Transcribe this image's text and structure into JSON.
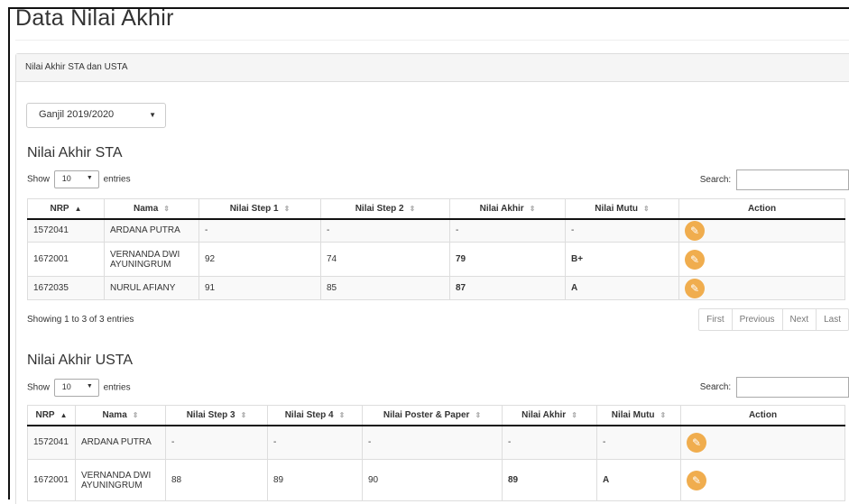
{
  "page_title": "Data Nilai Akhir",
  "panel": {
    "heading": "Nilai Akhir STA dan USTA",
    "semester": "Ganjil 2019/2020"
  },
  "colors": {
    "edit_button": "#f0ad4e",
    "row_stripe": "#f9f9f9"
  },
  "sta": {
    "title": "Nilai Akhir STA",
    "show_label": "Show",
    "entries_value": "10",
    "entries_label": "entries",
    "search_label": "Search:",
    "columns": [
      "NRP",
      "Nama",
      "Nilai Step 1",
      "Nilai Step 2",
      "Nilai Akhir",
      "Nilai Mutu",
      "Action"
    ],
    "rows": [
      {
        "nrp": "1572041",
        "nama": "ARDANA PUTRA",
        "step1": "-",
        "step2": "-",
        "akhir": "-",
        "mutu": "-"
      },
      {
        "nrp": "1672001",
        "nama": "VERNANDA DWI AYUNINGRUM",
        "step1": "92",
        "step2": "74",
        "akhir": "79",
        "mutu": "B+"
      },
      {
        "nrp": "1672035",
        "nama": "NURUL AFIANY",
        "step1": "91",
        "step2": "85",
        "akhir": "87",
        "mutu": "A"
      }
    ],
    "info": "Showing 1 to 3 of 3 entries",
    "pager": {
      "first": "First",
      "previous": "Previous",
      "next": "Next",
      "last": "Last"
    }
  },
  "usta": {
    "title": "Nilai Akhir USTA",
    "show_label": "Show",
    "entries_value": "10",
    "entries_label": "entries",
    "search_label": "Search:",
    "columns": [
      "NRP",
      "Nama",
      "Nilai Step 3",
      "Nilai Step 4",
      "Nilai Poster & Paper",
      "Nilai Akhir",
      "Nilai Mutu",
      "Action"
    ],
    "rows": [
      {
        "nrp": "1572041",
        "nama": "ARDANA PUTRA",
        "step3": "-",
        "step4": "-",
        "poster": "-",
        "akhir": "-",
        "mutu": "-"
      },
      {
        "nrp": "1672001",
        "nama": "VERNANDA DWI AYUNINGRUM",
        "step3": "88",
        "step4": "89",
        "poster": "90",
        "akhir": "89",
        "mutu": "A"
      }
    ]
  }
}
